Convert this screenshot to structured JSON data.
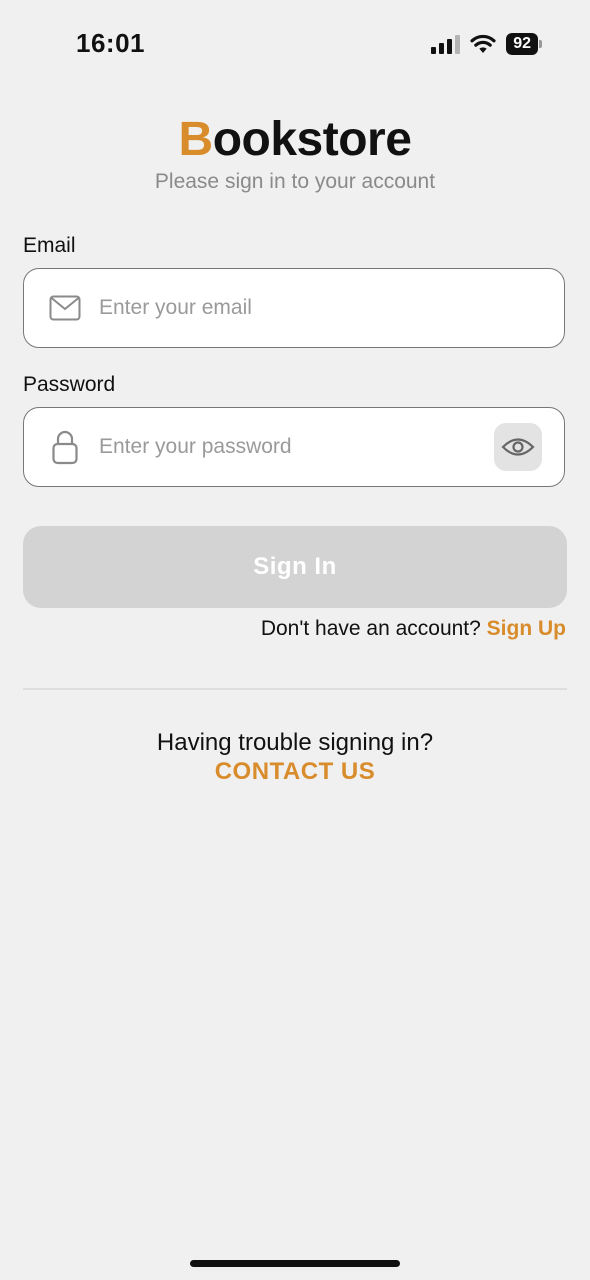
{
  "status_bar": {
    "time": "16:01",
    "battery": "92"
  },
  "header": {
    "brand_first_letter": "B",
    "brand_rest": "ookstore",
    "subtitle": "Please sign in to your account"
  },
  "form": {
    "email": {
      "label": "Email",
      "placeholder": "Enter your email",
      "value": "",
      "icon": "mail-icon"
    },
    "password": {
      "label": "Password",
      "placeholder": "Enter your password",
      "value": "",
      "icon": "lock-icon",
      "toggle_icon": "eye-icon"
    },
    "sign_in_label": "Sign In"
  },
  "signup": {
    "prompt": "Don't have an account?",
    "link_label": "Sign Up"
  },
  "help": {
    "prompt": "Having trouble signing in?",
    "link_label": "CONTACT US"
  },
  "colors": {
    "accent": "#d98c2b",
    "background": "#f0f0f0",
    "button_disabled": "#d3d3d3"
  }
}
